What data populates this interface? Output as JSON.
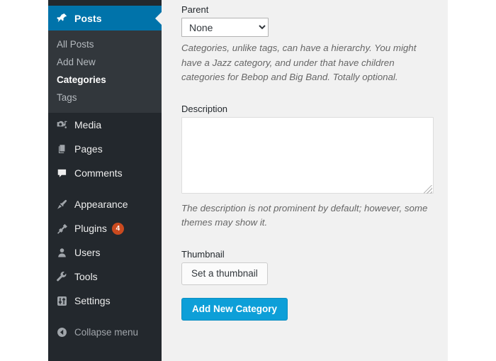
{
  "sidebar": {
    "active_item": {
      "label": "Posts",
      "icon": "pin-icon"
    },
    "submenu": [
      {
        "label": "All Posts",
        "current": false
      },
      {
        "label": "Add New",
        "current": false
      },
      {
        "label": "Categories",
        "current": true
      },
      {
        "label": "Tags",
        "current": false
      }
    ],
    "items": [
      {
        "label": "Media",
        "icon": "media-icon"
      },
      {
        "label": "Pages",
        "icon": "pages-icon"
      },
      {
        "label": "Comments",
        "icon": "comment-icon"
      },
      {
        "label": "Appearance",
        "icon": "paintbrush-icon"
      },
      {
        "label": "Plugins",
        "icon": "plug-icon",
        "badge": "4"
      },
      {
        "label": "Users",
        "icon": "user-icon"
      },
      {
        "label": "Tools",
        "icon": "wrench-icon"
      },
      {
        "label": "Settings",
        "icon": "sliders-icon"
      }
    ],
    "collapse": {
      "label": "Collapse menu",
      "icon": "collapse-arrow-icon"
    }
  },
  "form": {
    "parent": {
      "label": "Parent",
      "selected": "None",
      "options": [
        "None"
      ],
      "help": "Categories, unlike tags, can have a hierarchy. You might have a Jazz category, and under that have children categories for Bebop and Big Band. Totally optional."
    },
    "description": {
      "label": "Description",
      "value": "",
      "help": "The description is not prominent by default; however, some themes may show it."
    },
    "thumbnail": {
      "label": "Thumbnail",
      "button_label": "Set a thumbnail"
    },
    "submit_label": "Add New Category"
  },
  "colors": {
    "sidebar_bg": "#23282d",
    "submenu_bg": "#32373c",
    "active_blue": "#0073aa",
    "primary_button": "#0d9fd8",
    "badge_orange": "#ca4a1f",
    "content_bg": "#f1f1f1"
  }
}
